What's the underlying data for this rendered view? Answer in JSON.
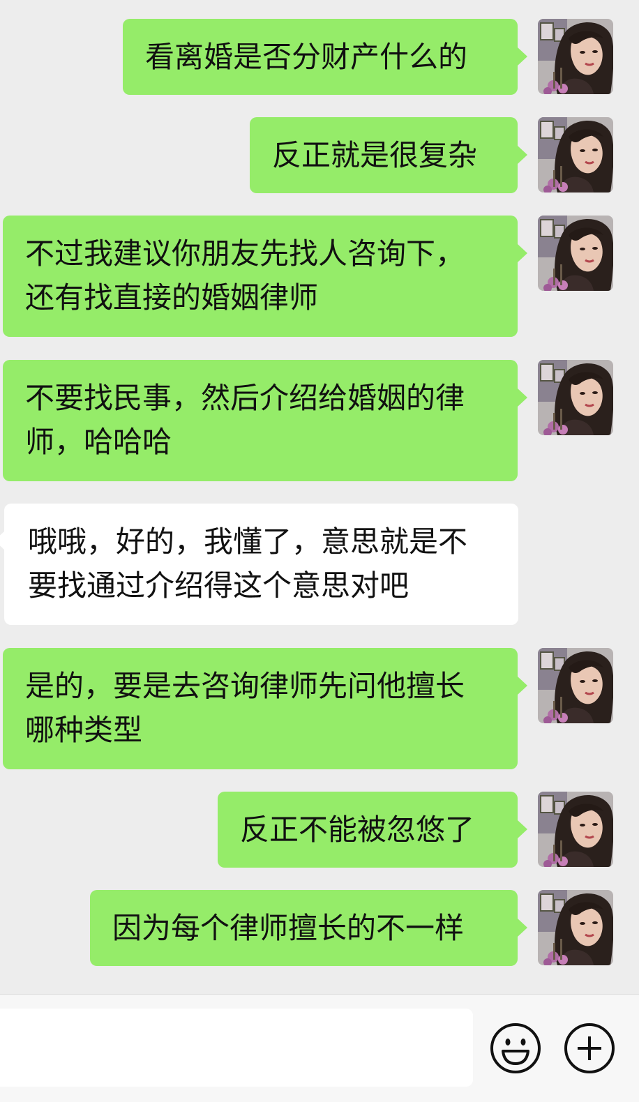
{
  "messages": [
    {
      "side": "right",
      "text": "看离婚是否分财产什么的"
    },
    {
      "side": "right",
      "text": "反正就是很复杂"
    },
    {
      "side": "right",
      "text": "不过我建议你朋友先找人咨询下，\n还有找直接的婚姻律师"
    },
    {
      "side": "right",
      "text": "不要找民事，然后介绍给婚姻的律\n师，哈哈哈"
    },
    {
      "side": "left",
      "text": "哦哦，好的，我懂了，意思就是不\n要找通过介绍得这个意思对吧"
    },
    {
      "side": "right",
      "text": "是的，要是去咨询律师先问他擅长\n哪种类型"
    },
    {
      "side": "right",
      "text": "反正不能被忽悠了"
    },
    {
      "side": "right",
      "text": "因为每个律师擅长的不一样"
    }
  ],
  "input": {
    "value": ""
  },
  "icons": {
    "emoji": "emoji-icon",
    "plus": "plus-icon",
    "avatar": "avatar"
  },
  "colors": {
    "sent_bubble": "#95ec69",
    "received_bubble": "#ffffff",
    "background": "#ededed"
  }
}
